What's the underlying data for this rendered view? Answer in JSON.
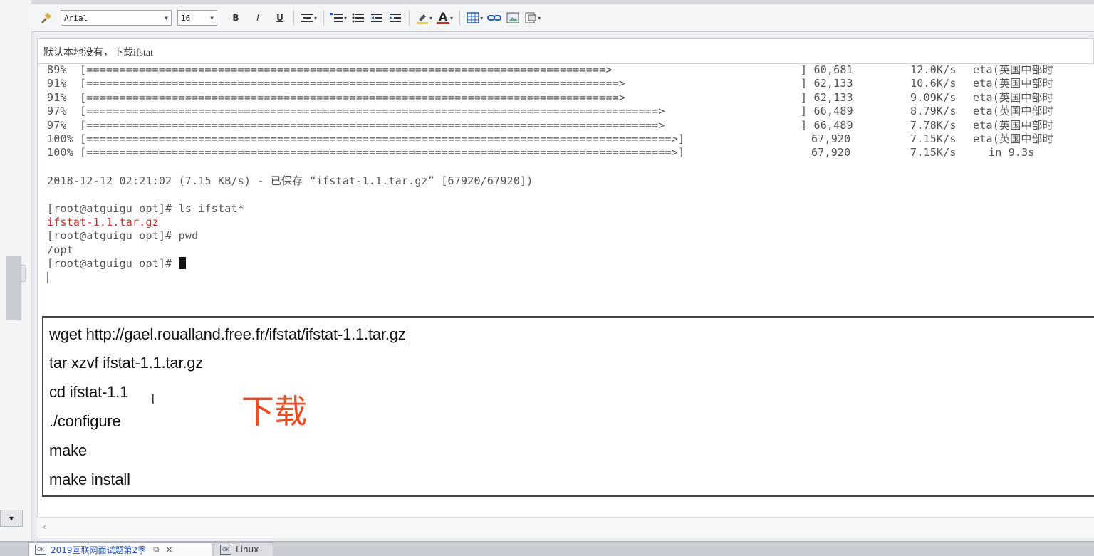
{
  "toolbar": {
    "font_name": "Arial",
    "font_size": "16",
    "bold_label": "B",
    "italic_label": "I",
    "underline_label": "U",
    "font_color_label": "A"
  },
  "note": {
    "subject": "默认本地没有，下载ifstat"
  },
  "terminal": {
    "progress_rows": [
      {
        "pct": "89%",
        "bar": "[===============================================================================>",
        "bytes": "] 60,681",
        "speed": "12.0K/s",
        "eta": "eta(英国中部时"
      },
      {
        "pct": "91%",
        "bar": "[=================================================================================>",
        "bytes": "] 62,133",
        "speed": "10.6K/s",
        "eta": "eta(英国中部时"
      },
      {
        "pct": "91%",
        "bar": "[=================================================================================>",
        "bytes": "] 62,133",
        "speed": "9.09K/s",
        "eta": "eta(英国中部时"
      },
      {
        "pct": "97%",
        "bar": "[=======================================================================================>",
        "bytes": "] 66,489",
        "speed": "8.79K/s",
        "eta": "eta(英国中部时"
      },
      {
        "pct": "97%",
        "bar": "[=======================================================================================>",
        "bytes": "] 66,489",
        "speed": "7.78K/s",
        "eta": "eta(英国中部时"
      },
      {
        "pct": "100%",
        "bar": "[=========================================================================================>]",
        "bytes": "67,920",
        "speed": "7.15K/s",
        "eta": "eta(英国中部时"
      },
      {
        "pct": "100%",
        "bar": "[=========================================================================================>]",
        "bytes": "67,920",
        "speed": "7.15K/s",
        "eta": "in 9.3s"
      }
    ],
    "saved_line": "2018-12-12 02:21:02 (7.15 KB/s) - 已保存 “ifstat-1.1.tar.gz” [67920/67920])",
    "cmd1": "[root@atguigu opt]# ls ifstat*",
    "ls_output": "ifstat-1.1.tar.gz",
    "cmd2": "[root@atguigu opt]# pwd",
    "pwd_output": "/opt",
    "prompt": "[root@atguigu opt]# "
  },
  "commands": {
    "lines": [
      "wget http://gael.roualland.free.fr/ifstat/ifstat-1.1.tar.gz",
      "tar xzvf ifstat-1.1.tar.gz",
      "cd ifstat-1.1",
      "./configure",
      "make",
      "make install"
    ],
    "annotation": "下载"
  },
  "tabs": [
    {
      "label": "2019互联网面试题第2季",
      "active": true
    },
    {
      "label": "Linux",
      "active": false
    }
  ],
  "colors": {
    "accent_red": "#ef4b1f",
    "terminal_red": "#d62b2b",
    "tab_active_text": "#1f4fb8"
  }
}
